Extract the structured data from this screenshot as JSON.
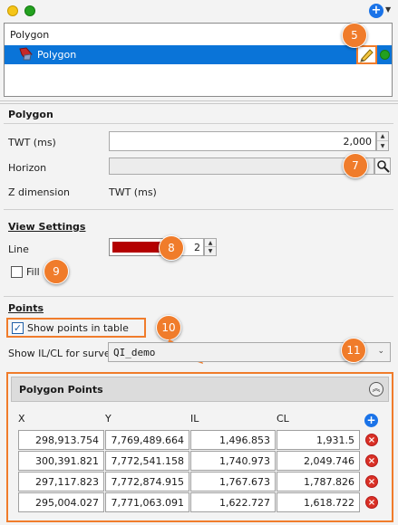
{
  "top_list": {
    "header": "Polygon",
    "selected_item": "Polygon"
  },
  "polygon_section": {
    "title": "Polygon",
    "twt_label": "TWT (ms)",
    "twt_value": "2,000",
    "horizon_label": "Horizon",
    "horizon_value": "",
    "zdim_label": "Z dimension",
    "zdim_value": "TWT (ms)"
  },
  "view_settings": {
    "title": "View Settings",
    "line_label": "Line",
    "line_color": "#b40000",
    "line_width": "2",
    "fill_label": "Fill"
  },
  "points_section": {
    "title": "Points",
    "show_in_table_label": "Show points in table",
    "survey_label": "Show IL/CL for survey",
    "survey_value": "QI_demo"
  },
  "polygon_points": {
    "title": "Polygon Points",
    "columns": [
      "X",
      "Y",
      "IL",
      "CL"
    ],
    "rows": [
      [
        "298,913.754",
        "7,769,489.664",
        "1,496.853",
        "1,931.5"
      ],
      [
        "300,391.821",
        "7,772,541.158",
        "1,740.973",
        "2,049.746"
      ],
      [
        "297,117.823",
        "7,772,874.915",
        "1,767.673",
        "1,787.826"
      ],
      [
        "295,004.027",
        "7,771,063.091",
        "1,622.727",
        "1,618.722"
      ]
    ]
  },
  "callouts": [
    "5",
    "7",
    "8",
    "9",
    "10",
    "11"
  ],
  "colors": {
    "accent_orange": "#f07c2b",
    "selection_blue": "#0a74d8",
    "status_green": "#23a11f",
    "status_yellow": "#f5c518"
  }
}
